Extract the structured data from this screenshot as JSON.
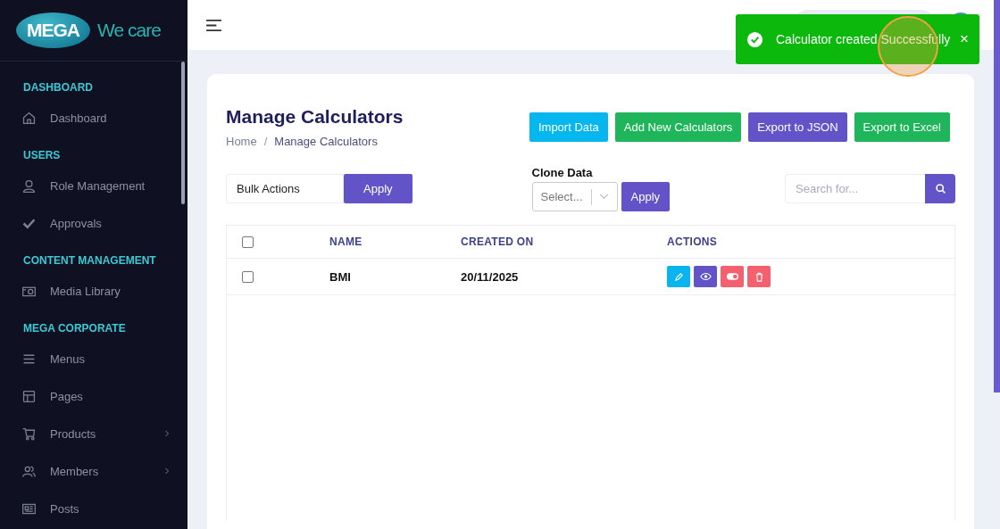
{
  "logo": {
    "brand": "MEGA",
    "tagline": "We care"
  },
  "sidebar": {
    "sections": [
      {
        "heading": "DASHBOARD",
        "items": [
          {
            "label": "Dashboard",
            "has_submenu": false
          }
        ]
      },
      {
        "heading": "USERS",
        "items": [
          {
            "label": "Role Management",
            "has_submenu": false
          },
          {
            "label": "Approvals",
            "has_submenu": false
          }
        ]
      },
      {
        "heading": "CONTENT MANAGEMENT",
        "items": [
          {
            "label": "Media Library",
            "has_submenu": false
          }
        ]
      },
      {
        "heading": "MEGA CORPORATE",
        "items": [
          {
            "label": "Menus",
            "has_submenu": false
          },
          {
            "label": "Pages",
            "has_submenu": false
          },
          {
            "label": "Products",
            "has_submenu": true
          },
          {
            "label": "Members",
            "has_submenu": true
          },
          {
            "label": "Posts",
            "has_submenu": false
          }
        ]
      }
    ]
  },
  "page": {
    "title": "Manage Calculators",
    "breadcrumb": [
      "Home",
      "Manage Calculators"
    ],
    "breadcrumb_separator": "/",
    "header_buttons": [
      {
        "label": "Import Data",
        "kind": "info"
      },
      {
        "label": "Add New Calculators",
        "kind": "success"
      },
      {
        "label": "Export to JSON",
        "kind": "primary"
      },
      {
        "label": "Export to Excel",
        "kind": "success"
      }
    ]
  },
  "toolbar": {
    "bulk_select": "Bulk Actions",
    "bulk_apply": "Apply",
    "clone_label": "Clone Data",
    "clone_placeholder": "Select...",
    "clone_apply": "Apply",
    "search_placeholder": "Search for..."
  },
  "table": {
    "select_all_checked": false,
    "columns": [
      "NAME",
      "CREATED ON",
      "ACTIONS"
    ],
    "rows": [
      {
        "checked": false,
        "name": "BMI",
        "created_on": "20/11/2025"
      }
    ]
  },
  "toast": {
    "message": "Calculator created Successfully",
    "close": "×"
  }
}
